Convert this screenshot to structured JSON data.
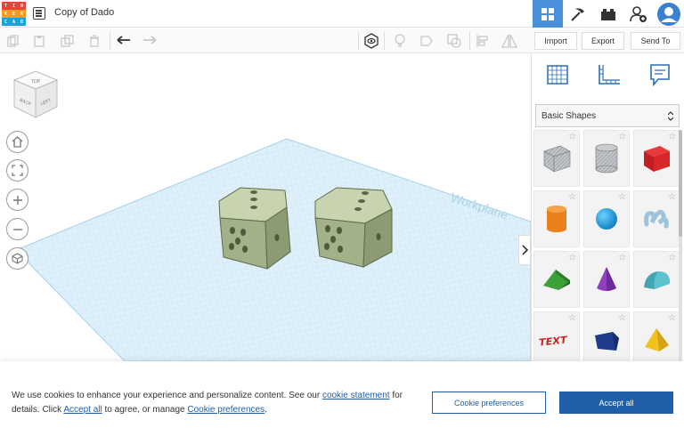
{
  "app": {
    "logo_letters": [
      "T",
      "I",
      "N",
      "K",
      "E",
      "R",
      "C",
      "A",
      "D"
    ],
    "logo_colors": [
      "#e2453c",
      "#e2453c",
      "#e2453c",
      "#f39a1f",
      "#f39a1f",
      "#f39a1f",
      "#1fa0d8",
      "#1fa0d8",
      "#1fa0d8"
    ],
    "document_title": "Copy of Dado"
  },
  "toolbar": {
    "import_label": "Import",
    "export_label": "Export",
    "send_to_label": "Send To"
  },
  "viewcube": {
    "back": "BACK",
    "left": "LEFT",
    "top": "TOP"
  },
  "workplane": {
    "label": "Workplane"
  },
  "panel": {
    "category": "Basic Shapes",
    "shapes": [
      "box-striped",
      "cylinder-striped",
      "box",
      "cylinder",
      "sphere",
      "scribble",
      "roof",
      "cone",
      "round-roof",
      "text",
      "shape-generator",
      "pyramid"
    ]
  },
  "cookie": {
    "text_1": "We use cookies to enhance your experience and personalize content. See our",
    "link_statement": "cookie statement",
    "text_2": "for details. Click",
    "link_accept": "Accept all",
    "text_3": "to agree, or manage",
    "link_prefs": "Cookie preferences",
    "text_4": ".",
    "btn_prefs": "Cookie preferences",
    "btn_accept": "Accept all"
  },
  "colors": {
    "accent": "#1e5fa8",
    "active_tab": "#4a8fd9",
    "grid": "#cfe9f6",
    "dice": "#9aab7f"
  }
}
